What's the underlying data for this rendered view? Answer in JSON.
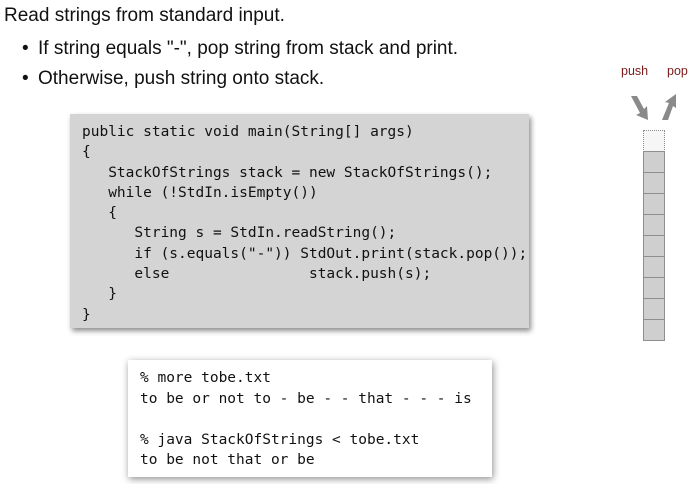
{
  "heading": "Read strings from standard input.",
  "bullets": [
    "If string equals \"-\", pop string from stack and print.",
    "Otherwise, push string onto stack."
  ],
  "code_lines": [
    "public static void main(String[] args)",
    "{",
    "   StackOfStrings stack = new StackOfStrings();",
    "   while (!StdIn.isEmpty())",
    "   {",
    "      String s = StdIn.readString();",
    "      if (s.equals(\"-\")) StdOut.print(stack.pop());",
    "      else                stack.push(s);",
    "   }",
    "}"
  ],
  "console_lines": [
    "% more tobe.txt",
    "to be or not to - be - - that - - - is",
    "",
    "% java StackOfStrings < tobe.txt",
    "to be not that or be"
  ],
  "stack": {
    "push_label": "push",
    "pop_label": "pop",
    "cells": 10,
    "colors": {
      "cell": "#cfcfcf",
      "empty": "#f6f6f6",
      "arrow": "#8a8a8a",
      "label": "#7a1a1a"
    }
  }
}
